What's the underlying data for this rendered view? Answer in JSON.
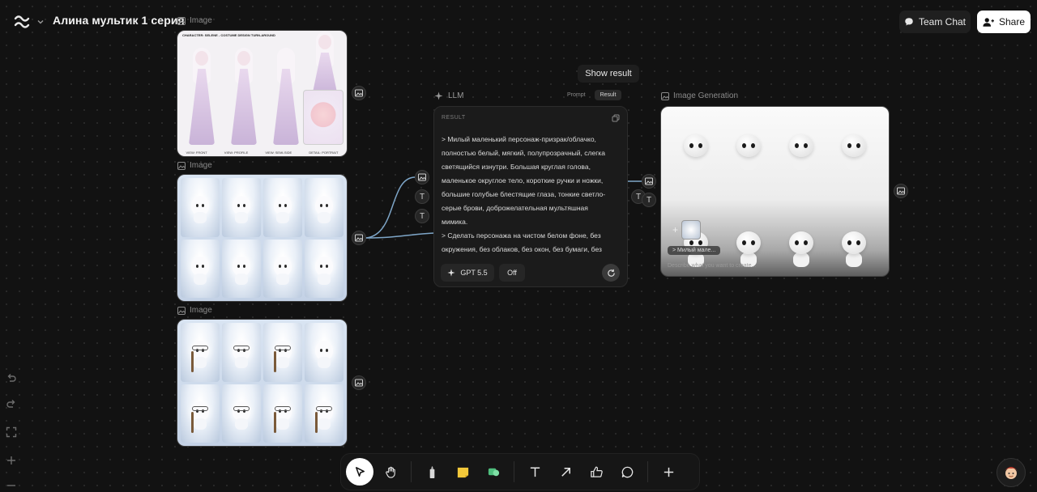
{
  "header": {
    "title": "Алина мультик 1 серия",
    "team_chat_label": "Team Chat",
    "share_label": "Share"
  },
  "nodes": {
    "image_label": "Image",
    "reference_sheet": {
      "header": "CHARACTER: SELENE - COSTUME DESIGN TURN-AROUND",
      "portrait_label": "DETAIL: PORTRAIT",
      "footer": [
        "VIEW: FRONT",
        "VIEW: PROFILE",
        "VIEW: SEMI-SIDE",
        "DETAIL: PORTRAIT"
      ]
    },
    "llm": {
      "label": "LLM",
      "show_result": "Show result",
      "tabs": [
        "Prompt",
        "Result"
      ],
      "active_tab": "Result",
      "result_label": "RESULT",
      "result_lines": [
        "> Милый маленький персонаж-призрак/облачко,",
        "полностью белый, мягкий, полупрозрачный, слегка",
        "светящийся изнутри. Большая круглая голова,",
        "маленькое округлое тело, короткие ручки и ножки,",
        "большие голубые блестящие глаза, тонкие светло-",
        "серые брови, доброжелательная мультяшная",
        "мимика.",
        "> Сделать персонажа на чистом белом фоне, без",
        "окружения, без облаков, без окон, без бумаги, без"
      ],
      "model_label": "GPT 5.5",
      "toggle_label": "Off"
    },
    "image_generation": {
      "label": "Image Generation",
      "chip": "> Милый мале...",
      "placeholder": "Describe what you want to create..."
    }
  },
  "ports": {
    "text_icon": "T"
  },
  "toolbar": {
    "tools": [
      "select-pointer-icon",
      "hand-icon",
      "marker-icon",
      "sticky-note-icon",
      "shapes-icon",
      "text-tool-icon",
      "arrow-icon",
      "thumbs-up-icon",
      "comment-icon",
      "add-icon"
    ]
  },
  "colors": {
    "accent_connector": "#7ea6c8",
    "background": "#121212"
  }
}
